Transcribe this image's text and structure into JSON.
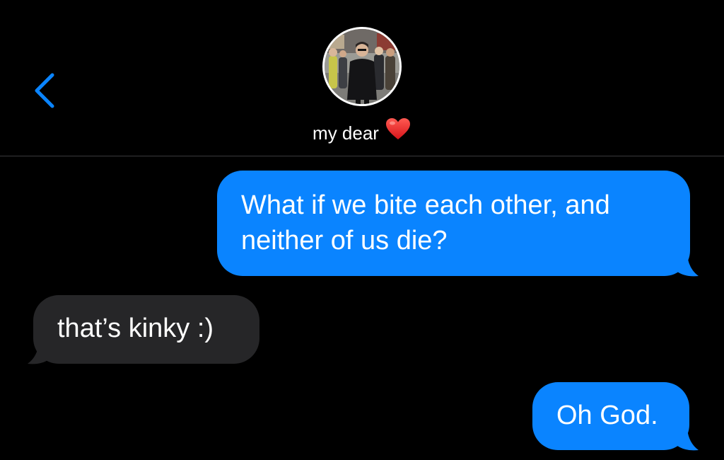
{
  "header": {
    "back_icon": "chevron-left-icon",
    "contact_name": "my dear",
    "contact_emoji": "red-heart-icon",
    "accent_color": "#0a84ff"
  },
  "messages": [
    {
      "direction": "sent",
      "text": "What if we bite each other, and neither of us die?"
    },
    {
      "direction": "received",
      "text": "that’s kinky :)"
    },
    {
      "direction": "sent",
      "text": "Oh God."
    }
  ],
  "colors": {
    "background": "#000000",
    "sent_bubble": "#0a84ff",
    "received_bubble": "#262628",
    "divider": "#3a3a3c"
  }
}
